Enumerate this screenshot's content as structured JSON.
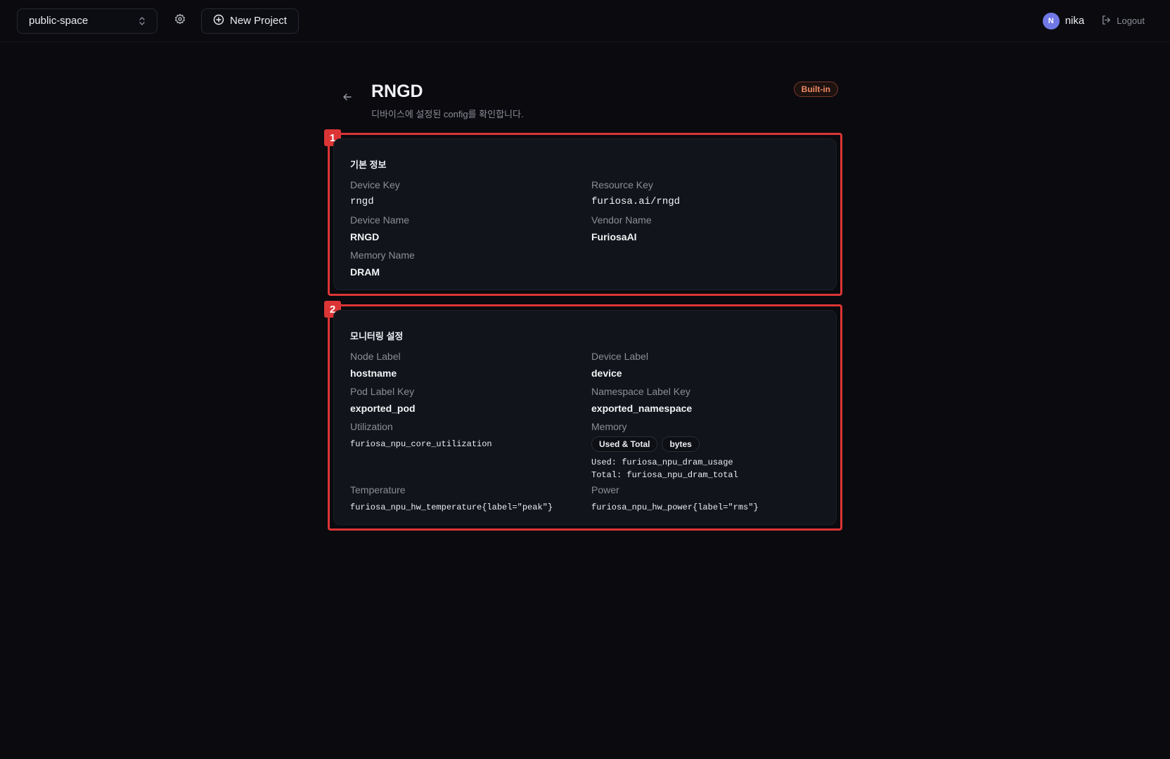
{
  "topbar": {
    "workspace": "public-space",
    "new_project_label": "New Project",
    "user_initial": "N",
    "username": "nika",
    "logout_label": "Logout"
  },
  "header": {
    "title": "RNGD",
    "subtitle": "디바이스에 설정된 config를 확인합니다.",
    "badge": "Built-in"
  },
  "sections": {
    "basic": {
      "tag": "1",
      "title": "기본 정보",
      "device_key_label": "Device Key",
      "device_key": "rngd",
      "resource_key_label": "Resource Key",
      "resource_key": "furiosa.ai/rngd",
      "device_name_label": "Device Name",
      "device_name": "RNGD",
      "vendor_name_label": "Vendor Name",
      "vendor_name": "FuriosaAI",
      "memory_name_label": "Memory Name",
      "memory_name": "DRAM"
    },
    "monitoring": {
      "tag": "2",
      "title": "모니터링 설정",
      "node_label_label": "Node Label",
      "node_label": "hostname",
      "device_label_label": "Device Label",
      "device_label": "device",
      "pod_label_key_label": "Pod Label Key",
      "pod_label_key": "exported_pod",
      "namespace_label_key_label": "Namespace Label Key",
      "namespace_label_key": "exported_namespace",
      "utilization_label": "Utilization",
      "utilization": "furiosa_npu_core_utilization",
      "memory_label": "Memory",
      "memory_chips": [
        "Used & Total",
        "bytes"
      ],
      "memory_used": "Used: furiosa_npu_dram_usage",
      "memory_total": "Total: furiosa_npu_dram_total",
      "temperature_label": "Temperature",
      "temperature": "furiosa_npu_hw_temperature{label=\"peak\"}",
      "power_label": "Power",
      "power": "furiosa_npu_hw_power{label=\"rms\"}"
    }
  },
  "colors": {
    "background": "#0a0a0f",
    "card": "#11141b",
    "highlight": "#dc3535",
    "badge_text": "#f08a62",
    "avatar": "#7078e6"
  },
  "icons": {
    "workspace": "chevron-up-down-icon",
    "settings": "gear-icon",
    "new_project": "plus-circle-icon",
    "logout": "logout-icon",
    "back": "arrow-left-icon"
  }
}
